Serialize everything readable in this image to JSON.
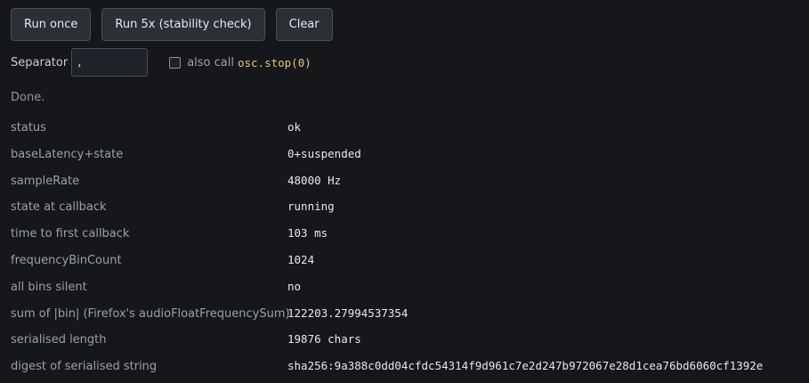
{
  "toolbar": {
    "run_once": "Run once",
    "run_5x": "Run 5x (stability check)",
    "clear": "Clear"
  },
  "separator": {
    "label": "Separator",
    "value": ","
  },
  "stop_option": {
    "label": "also call",
    "code": "osc.stop(0)",
    "checked": false
  },
  "status_text": "Done.",
  "results": [
    {
      "key": "status",
      "value": "ok"
    },
    {
      "key": "baseLatency+state",
      "value": "0+suspended"
    },
    {
      "key": "sampleRate",
      "value": "48000 Hz"
    },
    {
      "key": "state at callback",
      "value": "running"
    },
    {
      "key": "time to first callback",
      "value": "103 ms"
    },
    {
      "key": "frequencyBinCount",
      "value": "1024"
    },
    {
      "key": "all bins silent",
      "value": "no"
    },
    {
      "key": "sum of |bin| (Firefox's audioFloatFrequencySum)",
      "value": "122203.27994537354"
    },
    {
      "key": "serialised length",
      "value": "19876 chars"
    },
    {
      "key": "digest of serialised string",
      "value": "sha256:9a388c0dd04cfdc54314f9d961c7e2d247b972067e28d1cea76bd6060cf1392e"
    }
  ]
}
